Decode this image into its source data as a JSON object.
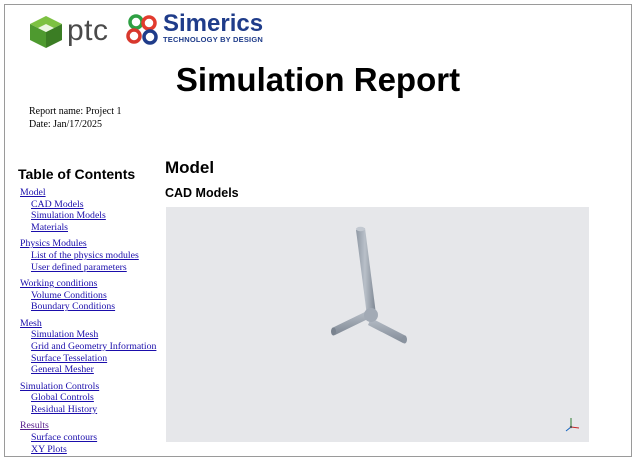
{
  "logos": {
    "ptc": "ptc",
    "simerics": "Simerics",
    "simerics_tagline": "TECHNOLOGY BY DESIGN"
  },
  "report": {
    "title": "Simulation Report",
    "name_line": "Report name: Project 1",
    "date_line": "Date: Jan/17/2025"
  },
  "toc": {
    "title": "Table of Contents",
    "sections": [
      {
        "label": "Model",
        "items": [
          "CAD Models",
          "Simulation Models",
          "Materials"
        ]
      },
      {
        "label": "Physics Modules",
        "items": [
          "List of the physics modules",
          "User defined parameters"
        ]
      },
      {
        "label": "Working conditions",
        "items": [
          "Volume Conditions",
          "Boundary Conditions"
        ]
      },
      {
        "label": "Mesh",
        "items": [
          "Simulation Mesh",
          "Grid and Geometry Information",
          "Surface Tesselation",
          "General Mesher"
        ]
      },
      {
        "label": "Simulation Controls",
        "items": [
          "Global Controls",
          "Residual History"
        ]
      },
      {
        "label": "Results",
        "items": [
          "Surface contours",
          "XY Plots"
        ]
      }
    ]
  },
  "content": {
    "section_heading": "Model",
    "subsection_heading": "CAD Models"
  },
  "viewer": {
    "background": "#e6e7ea",
    "model_color": "#9ea7b3",
    "axis_icon": "triad-axis-icon"
  },
  "colors": {
    "link": "#1a0dab",
    "visited_link": "#551a8b",
    "simerics_blue": "#1f3c8a",
    "ptc_green": "#5bb346"
  }
}
